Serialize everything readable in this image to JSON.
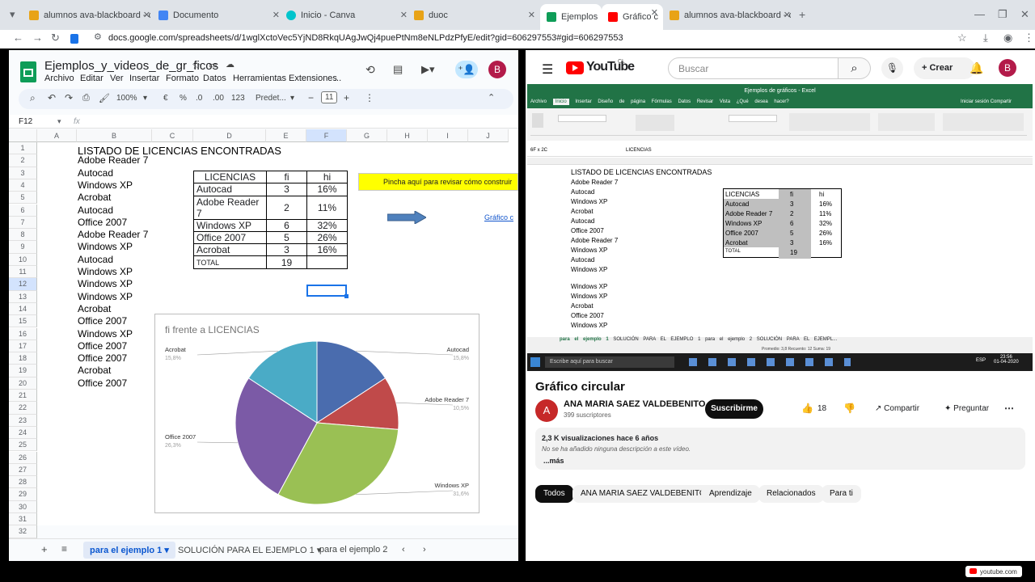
{
  "browser": {
    "tabs": [
      {
        "label": "alumnos ava-blackboard - duoc",
        "color": "#e8a317"
      },
      {
        "label": "Documento",
        "color": "#4285f4"
      },
      {
        "label": "Inicio - Canva",
        "color": "#00c4cc"
      },
      {
        "label": "duoc",
        "color": "#e8a317"
      },
      {
        "label": "Ejemplos",
        "color": "#0f9d58"
      },
      {
        "label": "Gráfico c",
        "color": "#ff0000"
      },
      {
        "label": "alumnos ava-blackboard - duoc",
        "color": "#e8a317"
      }
    ],
    "url": "docs.google.com/spreadsheets/d/1wglXctoVec5YjND8RkqUAgJwQj4puePtNm8eNLPdzPfyE/edit?gid=606297553#gid=606297553"
  },
  "sheets": {
    "doc_title": "Ejemplos_y_videos_de_gr_ficos",
    "menus": [
      "Archivo",
      "Editar",
      "Ver",
      "Insertar",
      "Formato",
      "Datos",
      "Herramientas",
      "Extensiones",
      "..."
    ],
    "avatar": "B",
    "zoom": "100%",
    "font": "Predet...",
    "font_size": "11",
    "cell_ref": "F12",
    "fx": "fx",
    "columns": [
      "A",
      "B",
      "C",
      "D",
      "E",
      "F",
      "G",
      "H",
      "I",
      "J"
    ],
    "rows": [
      "1",
      "2",
      "3",
      "4",
      "5",
      "6",
      "7",
      "8",
      "9",
      "10",
      "11",
      "12",
      "13",
      "14",
      "15",
      "16",
      "17",
      "18",
      "19",
      "20",
      "21",
      "22",
      "23",
      "24",
      "25",
      "26",
      "27",
      "28",
      "29",
      "30",
      "31",
      "32",
      "33"
    ],
    "title_cell": "LISTADO DE LICENCIAS ENCONTRADAS",
    "col_b": [
      "Adobe Reader 7",
      "Autocad",
      "Windows XP",
      "Acrobat",
      "Autocad",
      "Office 2007",
      "Adobe Reader 7",
      "Windows XP",
      "Autocad",
      "Windows XP",
      "Windows XP",
      "Windows XP",
      "Acrobat",
      "Office 2007",
      "Windows XP",
      "Office 2007",
      "Office 2007",
      "Acrobat",
      "Office 2007"
    ],
    "table": {
      "headers": [
        "LICENCIAS",
        "fi",
        "hi"
      ],
      "rows": [
        [
          "Autocad",
          "3",
          "16%"
        ],
        [
          "Adobe Reader 7",
          "2",
          "11%"
        ],
        [
          "Windows XP",
          "6",
          "32%"
        ],
        [
          "Office 2007",
          "5",
          "26%"
        ],
        [
          "Acrobat",
          "3",
          "16%"
        ],
        [
          "TOTAL",
          "19",
          ""
        ]
      ]
    },
    "link_box": "Pincha aquí para revisar cómo construir",
    "link_text": "Gráfico c",
    "sheet_tabs": [
      "para el ejemplo 1",
      "SOLUCIÓN PARA EL EJEMPLO 1",
      "para el ejemplo 2"
    ]
  },
  "chart_data": {
    "type": "pie",
    "title": "fi frente a LICENCIAS",
    "categories": [
      "Autocad",
      "Adobe Reader 7",
      "Windows XP",
      "Office 2007",
      "Acrobat"
    ],
    "values": [
      3,
      2,
      6,
      5,
      3
    ],
    "percent_labels": [
      "15,8%",
      "10,5%",
      "31,6%",
      "26,3%",
      "15,8%"
    ],
    "colors": [
      "#4a6cae",
      "#c04a4a",
      "#9ac054",
      "#7b5aa6",
      "#4aabc6"
    ]
  },
  "youtube": {
    "logo": "YouTube",
    "country": "CL",
    "search_placeholder": "Buscar",
    "create": "Crear",
    "avatar": "B",
    "video_title": "Gráfico circular",
    "channel": "ANA MARIA SAEZ VALDEBENITO",
    "channel_initial": "A",
    "subscribers": "399 suscriptores",
    "subscribe": "Suscribirme",
    "likes": "18",
    "share": "Compartir",
    "ask": "Preguntar",
    "views": "2,3 K visualizaciones  hace 6 años",
    "description": "No se ha añadido ninguna descripción a este vídeo.",
    "more": "...más",
    "chips": [
      "Todos",
      "ANA MARIA SAEZ VALDEBENITO",
      "Aprendizaje",
      "Relacionados",
      "Para ti"
    ],
    "watermark": "youtube.com"
  },
  "excel": {
    "title": "Ejemplos de gráficos - Excel",
    "ribbon_tabs": [
      "Archivo",
      "Inicio",
      "Insertar",
      "Diseño de página",
      "Fórmulas",
      "Datos",
      "Revisar",
      "Vista",
      "¿Qué desea hacer?",
      "Iniciar sesión",
      "Compartir"
    ],
    "name_box": "6F x 2C",
    "formula": "LICENCIAS",
    "title_cell": "LISTADO DE LICENCIAS ENCONTRADAS",
    "col_b": [
      "Adobe Reader 7",
      "Autocad",
      "Windows XP",
      "Acrobat",
      "Autocad",
      "Office 2007",
      "Adobe Reader 7",
      "Windows XP",
      "Autocad",
      "Windows XP",
      "Windows XP",
      "Windows XP",
      "Acrobat",
      "Office 2007",
      "Windows XP"
    ],
    "sheet_tabs": [
      "para el ejemplo 1",
      "SOLUCIÓN PARA EL EJEMPLO 1",
      "para el ejemplo 2",
      "SOLUCIÓN PARA EL EJEMPL..."
    ],
    "status": "Promedio: 3,8    Recuento: 12    Suma: 19",
    "taskbar_search": "Escribe aquí para buscar",
    "clock": "23:56",
    "date": "01-04-2020",
    "lang": "ESP"
  }
}
